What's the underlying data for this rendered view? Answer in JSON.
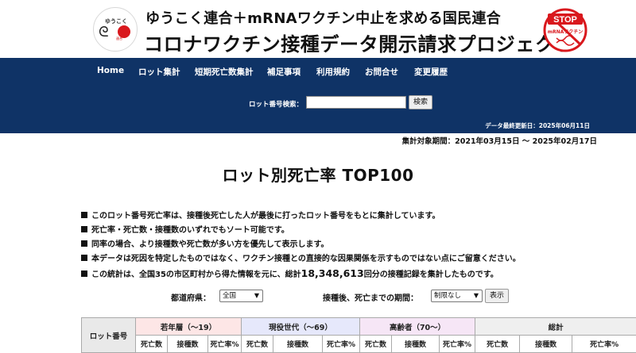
{
  "header": {
    "logo_text": "ゆうこく",
    "logo_subtext": "連合",
    "subtitle": "ゆうこく連合＋mRNAワクチン中止を求める国民連合",
    "title": "コロナワクチン接種データ開示請求プロジェクト",
    "badge_top": "STOP",
    "badge_bottom": "mRNAワクチン",
    "colors": {
      "brand_red": "#d9181d",
      "nav_bg": "#0f3366"
    }
  },
  "nav": {
    "items": [
      "Home",
      "ロット集計",
      "短期死亡数集計",
      "補足事項",
      "利用規約",
      "お問合せ",
      "変更履歴"
    ]
  },
  "search": {
    "label": "ロット番号検索：",
    "value": "",
    "placeholder": "",
    "button": "検索"
  },
  "updated": "データ最終更新日：2025年06月11日",
  "period": "集計対象期間：2021年03月15日 〜 2025年02月17日",
  "page_title": "ロット別死亡率 TOP100",
  "notes": [
    "このロット番号死亡率は、接種後死亡した人が最後に打ったロット番号をもとに集計しています。",
    "死亡率・死亡数・接種数のいずれでもソート可能です。",
    "同率の場合、より接種数や死亡数が多い方を優先して表示します。",
    "本データは死因を特定したものではなく、ワクチン接種との直接的な因果関係を示すものではない点にご留意ください。"
  ],
  "stat_note": {
    "prefix": "この統計は、全国35の市区町村から得た情報を元に、総計",
    "count": "18,348,613",
    "suffix": "回分の接種記録を集計したものです。"
  },
  "filters": {
    "prefecture_label": "都道府県：",
    "prefecture_value": "全国",
    "days_label": "接種後、死亡までの期間：",
    "days_value": "制限なし",
    "show_button": "表示"
  },
  "table": {
    "lot_header": "ロット番号",
    "groups": [
      "若年層（〜19）",
      "現役世代（〜69）",
      "高齢者（70〜）",
      "総計"
    ],
    "sub_headers": [
      "死亡数",
      "接種数",
      "死亡率%"
    ]
  }
}
